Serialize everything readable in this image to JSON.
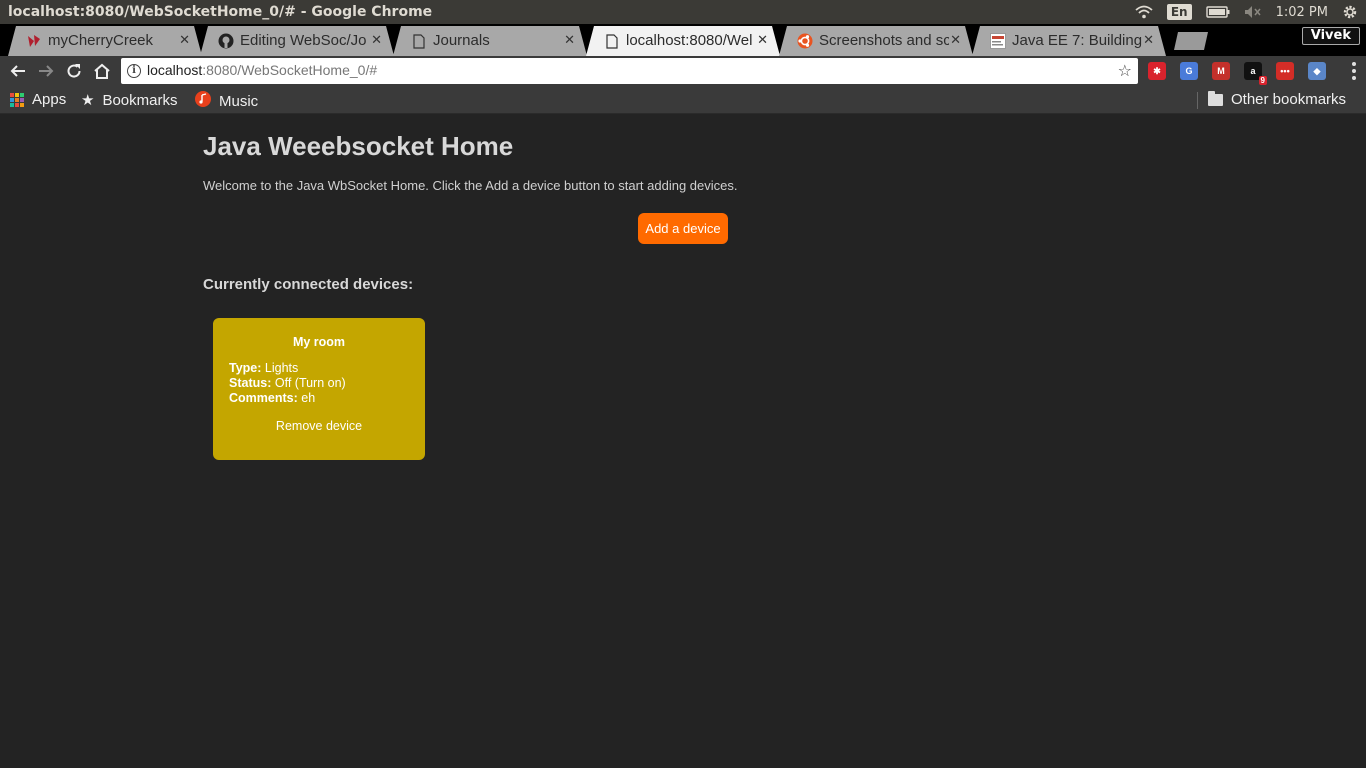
{
  "os": {
    "window_title": "localhost:8080/WebSocketHome_0/# - Google Chrome",
    "keyboard_layout": "En",
    "clock": "1:02 PM"
  },
  "tabs": [
    {
      "title": "myCherryCreek",
      "icon": "cherrycreek-icon",
      "active": false
    },
    {
      "title": "Editing WebSoc/Jo",
      "icon": "github-icon",
      "active": false
    },
    {
      "title": "Journals",
      "icon": "page-icon",
      "active": false
    },
    {
      "title": "localhost:8080/Wel",
      "icon": "page-icon",
      "active": true
    },
    {
      "title": "Screenshots and sc",
      "icon": "ubuntu-icon",
      "active": false
    },
    {
      "title": "Java EE 7: Building",
      "icon": "oracle-icon",
      "active": false
    }
  ],
  "tab_close_glyph": "✕",
  "profile_name": "Vivek",
  "omnibox": {
    "host": "localhost",
    "rest": ":8080/WebSocketHome_0/#"
  },
  "extensions": [
    {
      "name": "ext-red-icon",
      "color": "#d9232d",
      "label": "✱"
    },
    {
      "name": "google-translate-icon",
      "color": "#4a7bd9",
      "label": "G"
    },
    {
      "name": "gmail-icon",
      "color": "#c4302b",
      "label": "M"
    },
    {
      "name": "amazon-icon",
      "color": "#111111",
      "label": "a",
      "badge": "9"
    },
    {
      "name": "lastpass-icon",
      "color": "#d32d27",
      "label": "•••"
    },
    {
      "name": "cube-icon",
      "color": "#5a86c8",
      "label": "◆"
    }
  ],
  "bookmarks": {
    "apps": "Apps",
    "bookmarks": "Bookmarks",
    "music": "Music",
    "other": "Other bookmarks"
  },
  "page": {
    "heading": "Java Weeebsocket Home",
    "welcome": "Welcome to the Java WbSocket Home. Click the Add a device button to start adding devices.",
    "add_button": "Add a device",
    "devices_title": "Currently connected devices:",
    "devices": [
      {
        "name": "My room",
        "type_label": "Type:",
        "type": "Lights",
        "status_label": "Status:",
        "status": "Off (Turn on)",
        "comments_label": "Comments:",
        "comments": "eh",
        "remove": "Remove device"
      }
    ]
  },
  "colors": {
    "accent_button": "#ff6a00",
    "card": "#c4a600",
    "page_bg": "#232323"
  }
}
